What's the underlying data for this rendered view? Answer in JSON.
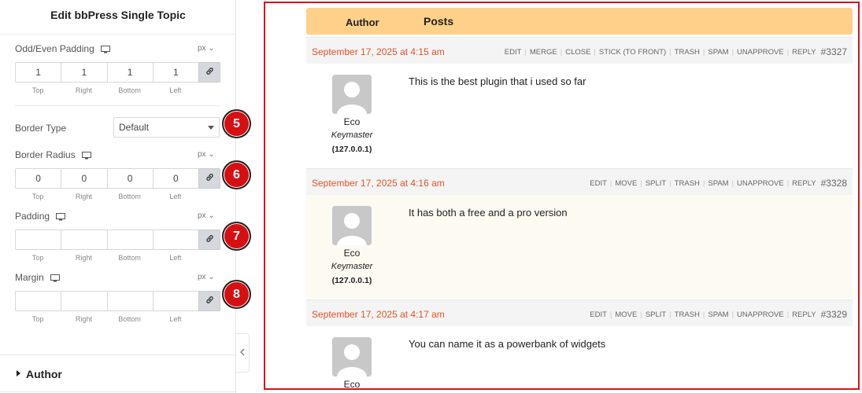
{
  "panel": {
    "title": "Edit bbPress Single Topic",
    "side_labels": [
      "Top",
      "Right",
      "Bottom",
      "Left"
    ],
    "odd_even_padding": {
      "label": "Odd/Even Padding",
      "unit": "px",
      "values": [
        "1",
        "1",
        "1",
        "1"
      ]
    },
    "border_type": {
      "label": "Border Type",
      "value": "Default",
      "badge": "5"
    },
    "border_radius": {
      "label": "Border Radius",
      "unit": "px",
      "values": [
        "0",
        "0",
        "0",
        "0"
      ],
      "badge": "6"
    },
    "padding": {
      "label": "Padding",
      "unit": "px",
      "values": [
        "",
        "",
        "",
        ""
      ],
      "badge": "7"
    },
    "margin": {
      "label": "Margin",
      "unit": "px",
      "values": [
        "",
        "",
        "",
        ""
      ],
      "badge": "8"
    },
    "author_section": "Author",
    "badge_color": "#d50f12"
  },
  "preview": {
    "frame_color": "#d6121b",
    "header": {
      "author": "Author",
      "posts": "Posts",
      "background": "#ffd08a"
    },
    "replies": [
      {
        "date": "September 17, 2025 at 4:15 am",
        "links": [
          "EDIT",
          "MERGE",
          "CLOSE",
          "STICK (TO FRONT)",
          "TRASH",
          "SPAM",
          "UNAPPROVE",
          "REPLY"
        ],
        "id": "#3327",
        "author": "Eco",
        "role": "Keymaster",
        "ip": "(127.0.0.1)",
        "content": "This is the best plugin that i used so far"
      },
      {
        "date": "September 17, 2025 at 4:16 am",
        "links": [
          "EDIT",
          "MOVE",
          "SPLIT",
          "TRASH",
          "SPAM",
          "UNAPPROVE",
          "REPLY"
        ],
        "id": "#3328",
        "author": "Eco",
        "role": "Keymaster",
        "ip": "(127.0.0.1)",
        "content": "It has both a free and a pro version"
      },
      {
        "date": "September 17, 2025 at 4:17 am",
        "links": [
          "EDIT",
          "MOVE",
          "SPLIT",
          "TRASH",
          "SPAM",
          "UNAPPROVE",
          "REPLY"
        ],
        "id": "#3329",
        "author": "Eco",
        "role": "",
        "ip": "",
        "content": "You can name it as a powerbank of widgets"
      }
    ],
    "date_color": "#e2532c"
  }
}
